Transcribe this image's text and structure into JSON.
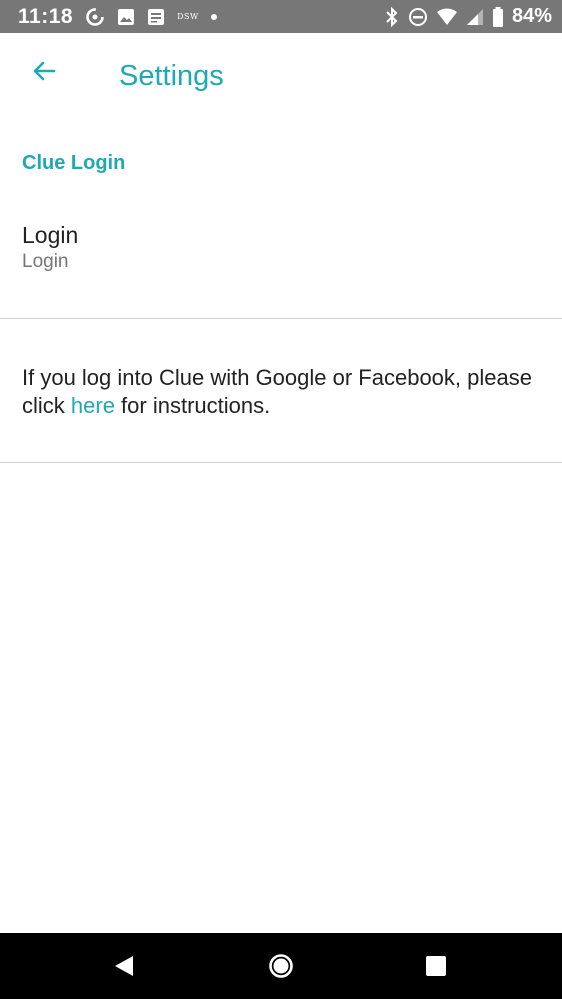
{
  "status_bar": {
    "time": "11:18",
    "carrier_badge": "DSW",
    "battery": "84%",
    "left_icons": [
      "sync-icon",
      "image-icon",
      "news-icon"
    ],
    "right_icons": [
      "bluetooth-icon",
      "do-not-disturb-icon",
      "wifi-icon",
      "signal-icon",
      "battery-icon"
    ]
  },
  "header": {
    "title": "Settings",
    "back_icon": "arrow-left-icon"
  },
  "section": {
    "title": "Clue Login"
  },
  "login_item": {
    "title": "Login",
    "subtitle": "Login"
  },
  "info": {
    "text_before": "If you log into Clue with Google or Facebook, please click ",
    "link": "here",
    "text_after": " for instructions."
  },
  "nav_bar": {
    "buttons": [
      "back-triangle-icon",
      "home-circle-icon",
      "recents-square-icon"
    ]
  },
  "colors": {
    "accent": "#1fa9b1",
    "status_bar": "#777777",
    "text": "#222222",
    "secondary_text": "#777777",
    "divider": "#cfcfcf"
  }
}
